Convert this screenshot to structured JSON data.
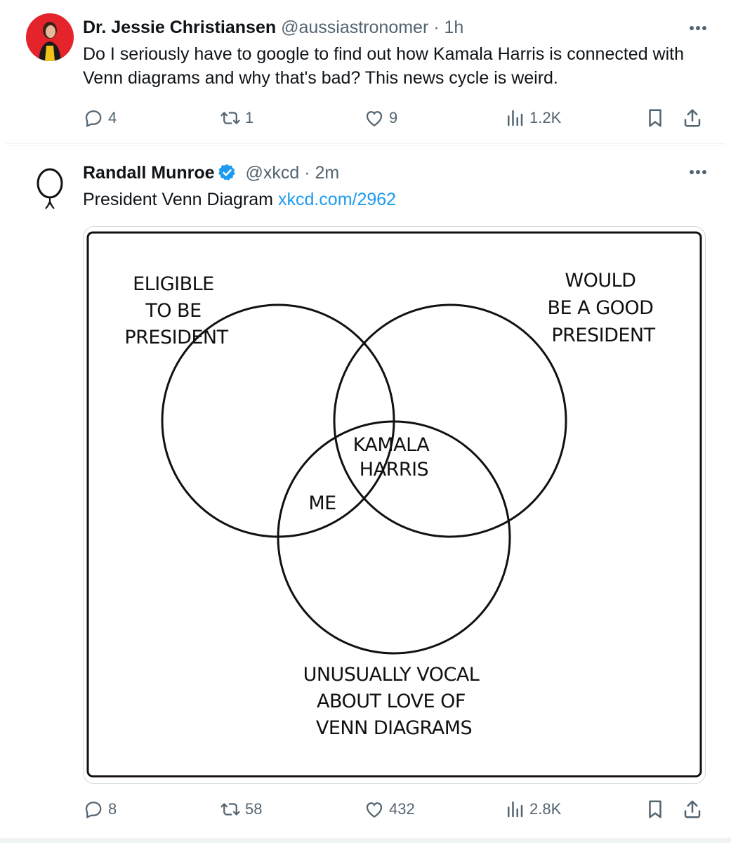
{
  "tweets": [
    {
      "name": "Dr. Jessie Christiansen",
      "handle": "@aussiastronomer",
      "time": "· 1h",
      "text": "Do I seriously have to google to find out how Kamala Harris is connected with Venn diagrams and why that's bad? This news cycle is weird.",
      "replies": "4",
      "retweets": "1",
      "likes": "9",
      "views": "1.2K"
    },
    {
      "name": "Randall Munroe",
      "handle": "@xkcd",
      "time": "· 2m",
      "verified": true,
      "text": "President Venn Diagram ",
      "link": "xkcd.com/2962",
      "replies": "8",
      "retweets": "58",
      "likes": "432",
      "views": "2.8K"
    }
  ],
  "comic": {
    "label_eligible": [
      "ELIGIBLE",
      "TO BE",
      "PRESIDENT"
    ],
    "label_good": [
      "WOULD",
      "BE A GOOD",
      "PRESIDENT"
    ],
    "label_vocal": [
      "UNUSUALLY VOCAL",
      "ABOUT LOVE OF",
      "VENN DIAGRAMS"
    ],
    "label_center": [
      "KAMALA",
      "HARRIS"
    ],
    "label_me": "ME"
  },
  "colors": {
    "accent": "#1d9bf0",
    "muted": "#536471",
    "avatar_bg": "#e4242a"
  },
  "icons": [
    "reply-icon",
    "retweet-icon",
    "like-icon",
    "views-icon",
    "bookmark-icon",
    "share-icon",
    "more-icon",
    "verified-icon"
  ]
}
